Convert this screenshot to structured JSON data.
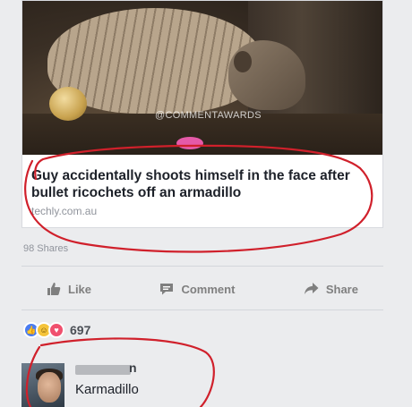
{
  "post": {
    "image_watermark": "@COMMENTAWARDS",
    "headline": "Guy accidentally shoots himself in the face after bullet ricochets off an armadillo",
    "domain": "techly.com.au",
    "shares": "98 Shares"
  },
  "actions": {
    "like": "Like",
    "comment": "Comment",
    "share": "Share"
  },
  "reactions": {
    "count": "697"
  },
  "comment": {
    "author_visible_suffix": "n",
    "text": "Karmadillo"
  },
  "colors": {
    "marker_red": "#d0202b",
    "action_gray": "#7f7f7f",
    "like_blue": "#4a7cf0",
    "love_red": "#f0506e",
    "haha_yellow": "#f5c43a"
  }
}
